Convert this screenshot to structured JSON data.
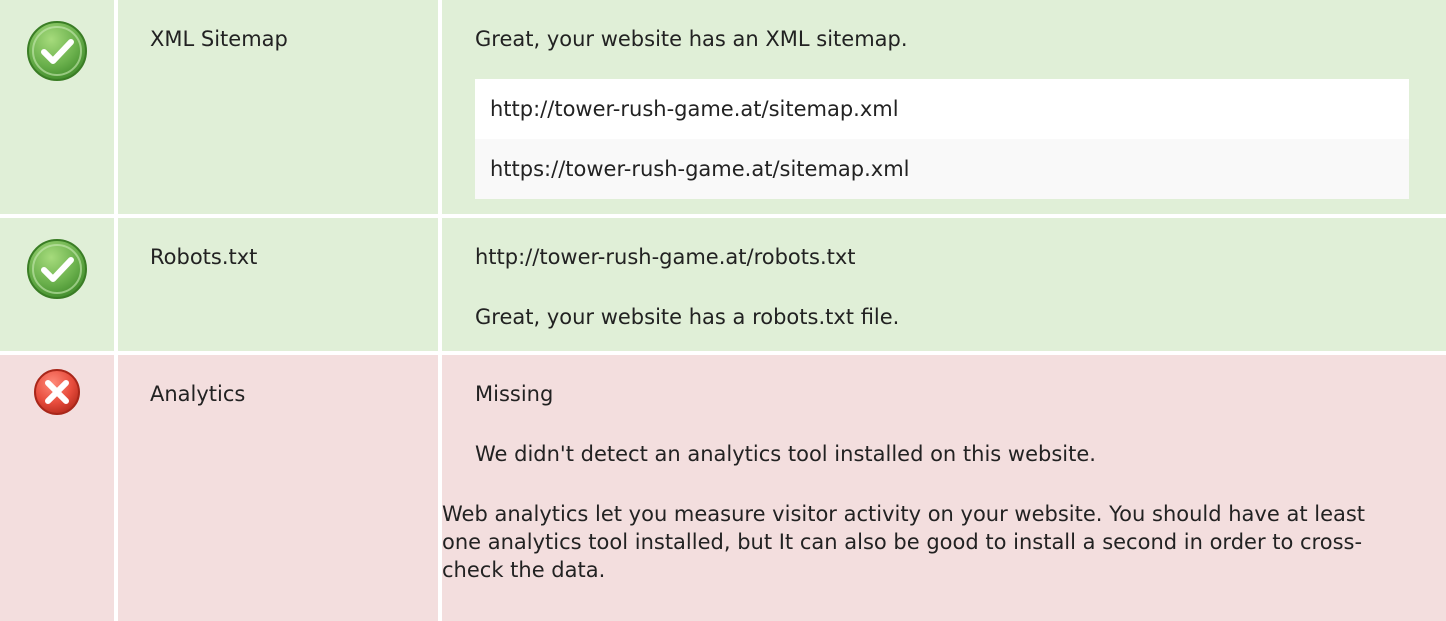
{
  "colors": {
    "success_bg": "#e0efd7",
    "error_bg": "#f3dede",
    "success_icon": "#6ab04c",
    "error_icon": "#e74c3c"
  },
  "rows": [
    {
      "status_icon": "checkmark-icon",
      "name": "XML Sitemap",
      "message": "Great, your website has an XML sitemap.",
      "urls": [
        "http://tower-rush-game.at/sitemap.xml",
        "https://tower-rush-game.at/sitemap.xml"
      ]
    },
    {
      "status_icon": "checkmark-icon",
      "name": "Robots.txt",
      "url": "http://tower-rush-game.at/robots.txt",
      "message": "Great, your website has a robots.txt file."
    },
    {
      "status_icon": "error-icon",
      "name": "Analytics",
      "status": "Missing",
      "message": "We didn't detect an analytics tool installed on this website.",
      "description": "Web analytics let you measure visitor activity on your website. You should have at least one analytics tool installed, but It can also be good to install a second in order to cross-check the data."
    }
  ]
}
